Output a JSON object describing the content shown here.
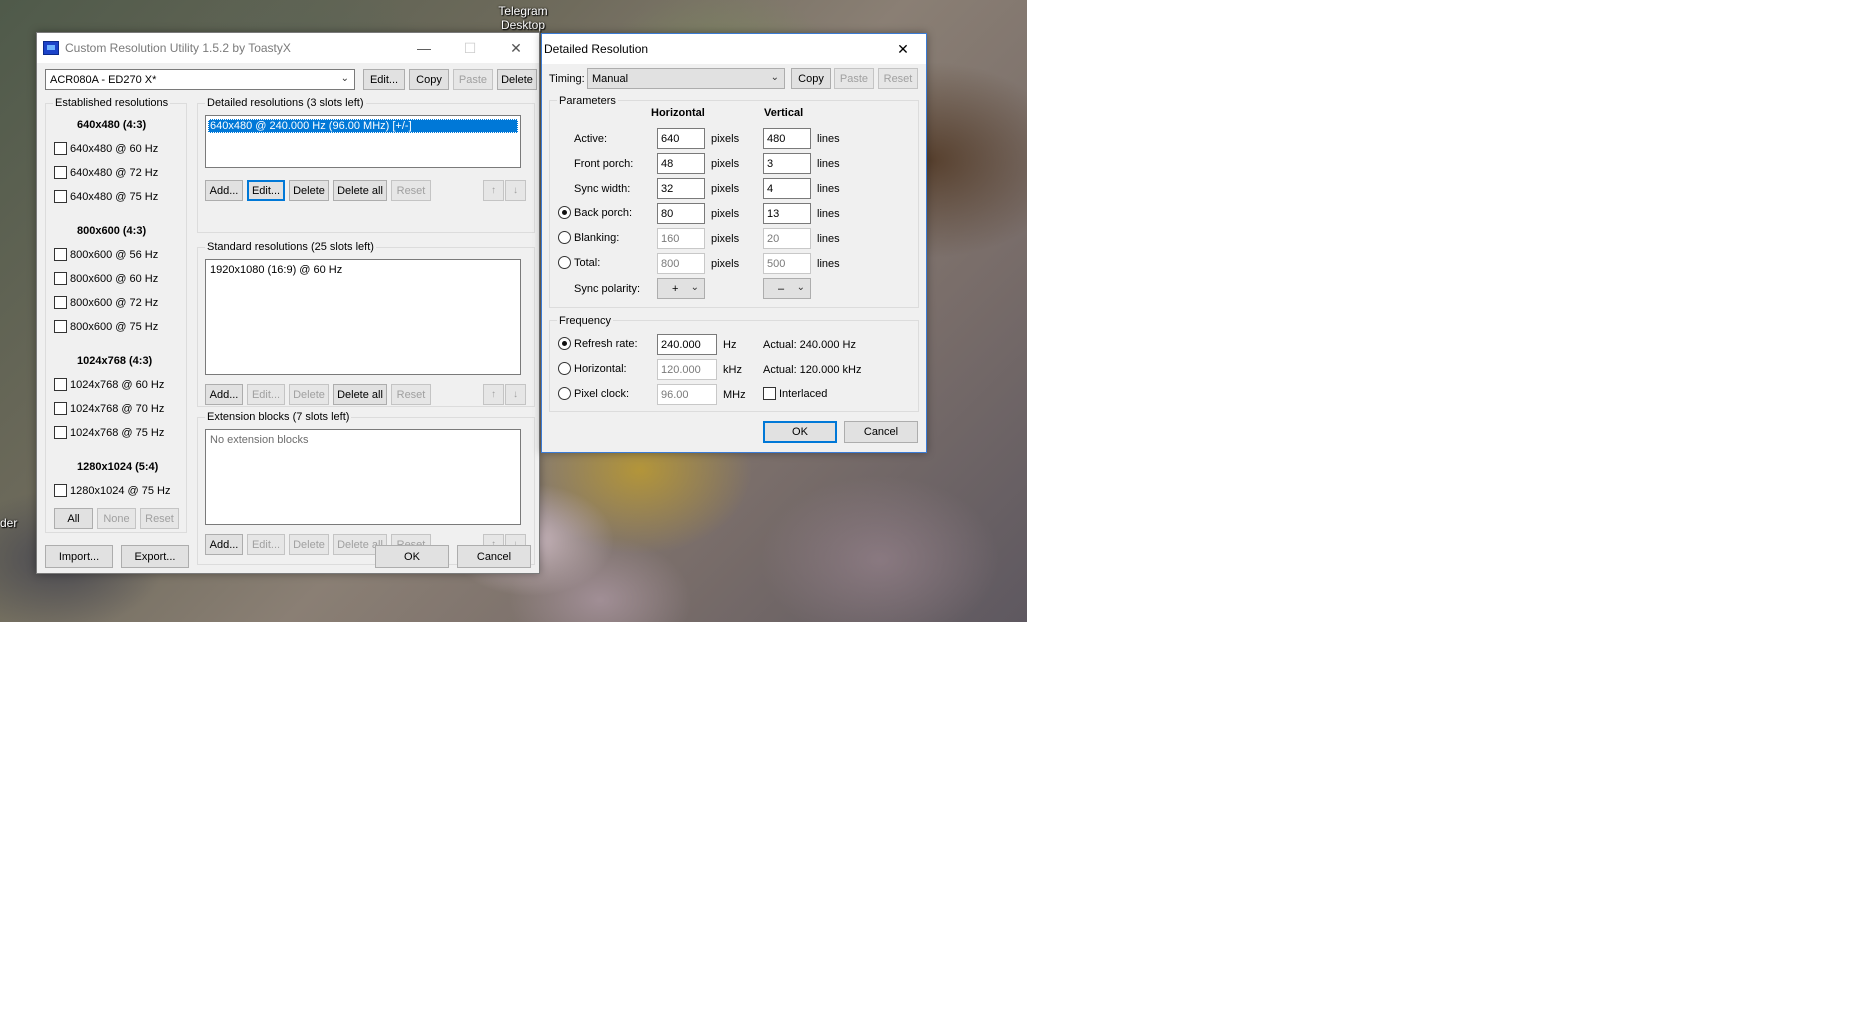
{
  "desktop": {
    "telegram_label": "Telegram Desktop",
    "partial_label": "der"
  },
  "main_window": {
    "title": "Custom Resolution Utility 1.5.2 by ToastyX",
    "monitor_select": "ACR080A - ED270 X*",
    "top_buttons": {
      "edit": "Edit...",
      "copy": "Copy",
      "paste": "Paste",
      "delete": "Delete"
    },
    "established": {
      "title": "Established resolutions",
      "groups": [
        {
          "heading": "640x480 (4:3)",
          "items": [
            "640x480 @ 60 Hz",
            "640x480 @ 72 Hz",
            "640x480 @ 75 Hz"
          ]
        },
        {
          "heading": "800x600 (4:3)",
          "items": [
            "800x600 @ 56 Hz",
            "800x600 @ 60 Hz",
            "800x600 @ 72 Hz",
            "800x600 @ 75 Hz"
          ]
        },
        {
          "heading": "1024x768 (4:3)",
          "items": [
            "1024x768 @ 60 Hz",
            "1024x768 @ 70 Hz",
            "1024x768 @ 75 Hz"
          ]
        },
        {
          "heading": "1280x1024 (5:4)",
          "items": [
            "1280x1024 @ 75 Hz"
          ]
        }
      ],
      "buttons": {
        "all": "All",
        "none": "None",
        "reset": "Reset"
      }
    },
    "detailed": {
      "title": "Detailed resolutions (3 slots left)",
      "items": [
        "640x480 @ 240.000 Hz (96.00 MHz) [+/-]"
      ],
      "buttons": {
        "add": "Add...",
        "edit": "Edit...",
        "delete": "Delete",
        "delete_all": "Delete all",
        "reset": "Reset"
      }
    },
    "standard": {
      "title": "Standard resolutions (25 slots left)",
      "items": [
        "1920x1080 (16:9) @ 60 Hz"
      ],
      "buttons": {
        "add": "Add...",
        "edit": "Edit...",
        "delete": "Delete",
        "delete_all": "Delete all",
        "reset": "Reset"
      }
    },
    "extension": {
      "title": "Extension blocks (7 slots left)",
      "items": [
        "No extension blocks"
      ],
      "buttons": {
        "add": "Add...",
        "edit": "Edit...",
        "delete": "Delete",
        "delete_all": "Delete all",
        "reset": "Reset"
      }
    },
    "arrows": {
      "up": "↑",
      "down": "↓"
    },
    "bottom_buttons": {
      "import": "Import...",
      "export": "Export...",
      "ok": "OK",
      "cancel": "Cancel"
    }
  },
  "detail_window": {
    "title": "Detailed Resolution",
    "timing_label": "Timing:",
    "timing_value": "Manual",
    "buttons": {
      "copy": "Copy",
      "paste": "Paste",
      "reset": "Reset",
      "ok": "OK",
      "cancel": "Cancel"
    },
    "parameters": {
      "title": "Parameters",
      "col_horizontal": "Horizontal",
      "col_vertical": "Vertical",
      "unit_h": "pixels",
      "unit_v": "lines",
      "rows": [
        {
          "label": "Active:",
          "h": "640",
          "v": "480",
          "radio": false
        },
        {
          "label": "Front porch:",
          "h": "48",
          "v": "3",
          "radio": false
        },
        {
          "label": "Sync width:",
          "h": "32",
          "v": "4",
          "radio": false
        },
        {
          "label": "Back porch:",
          "h": "80",
          "v": "13",
          "radio": true,
          "checked": true
        },
        {
          "label": "Blanking:",
          "h": "160",
          "v": "20",
          "radio": true,
          "checked": false
        },
        {
          "label": "Total:",
          "h": "800",
          "v": "500",
          "radio": true,
          "checked": false
        }
      ],
      "sync_polarity_label": "Sync polarity:",
      "sync_h": "+",
      "sync_v": "–"
    },
    "frequency": {
      "title": "Frequency",
      "rows": [
        {
          "label": "Refresh rate:",
          "value": "240.000",
          "unit": "Hz",
          "actual": "Actual: 240.000 Hz",
          "checked": true
        },
        {
          "label": "Horizontal:",
          "value": "120.000",
          "unit": "kHz",
          "actual": "Actual: 120.000 kHz",
          "checked": false
        },
        {
          "label": "Pixel clock:",
          "value": "96.00",
          "unit": "MHz",
          "checked": false
        }
      ],
      "interlaced_label": "Interlaced"
    }
  }
}
